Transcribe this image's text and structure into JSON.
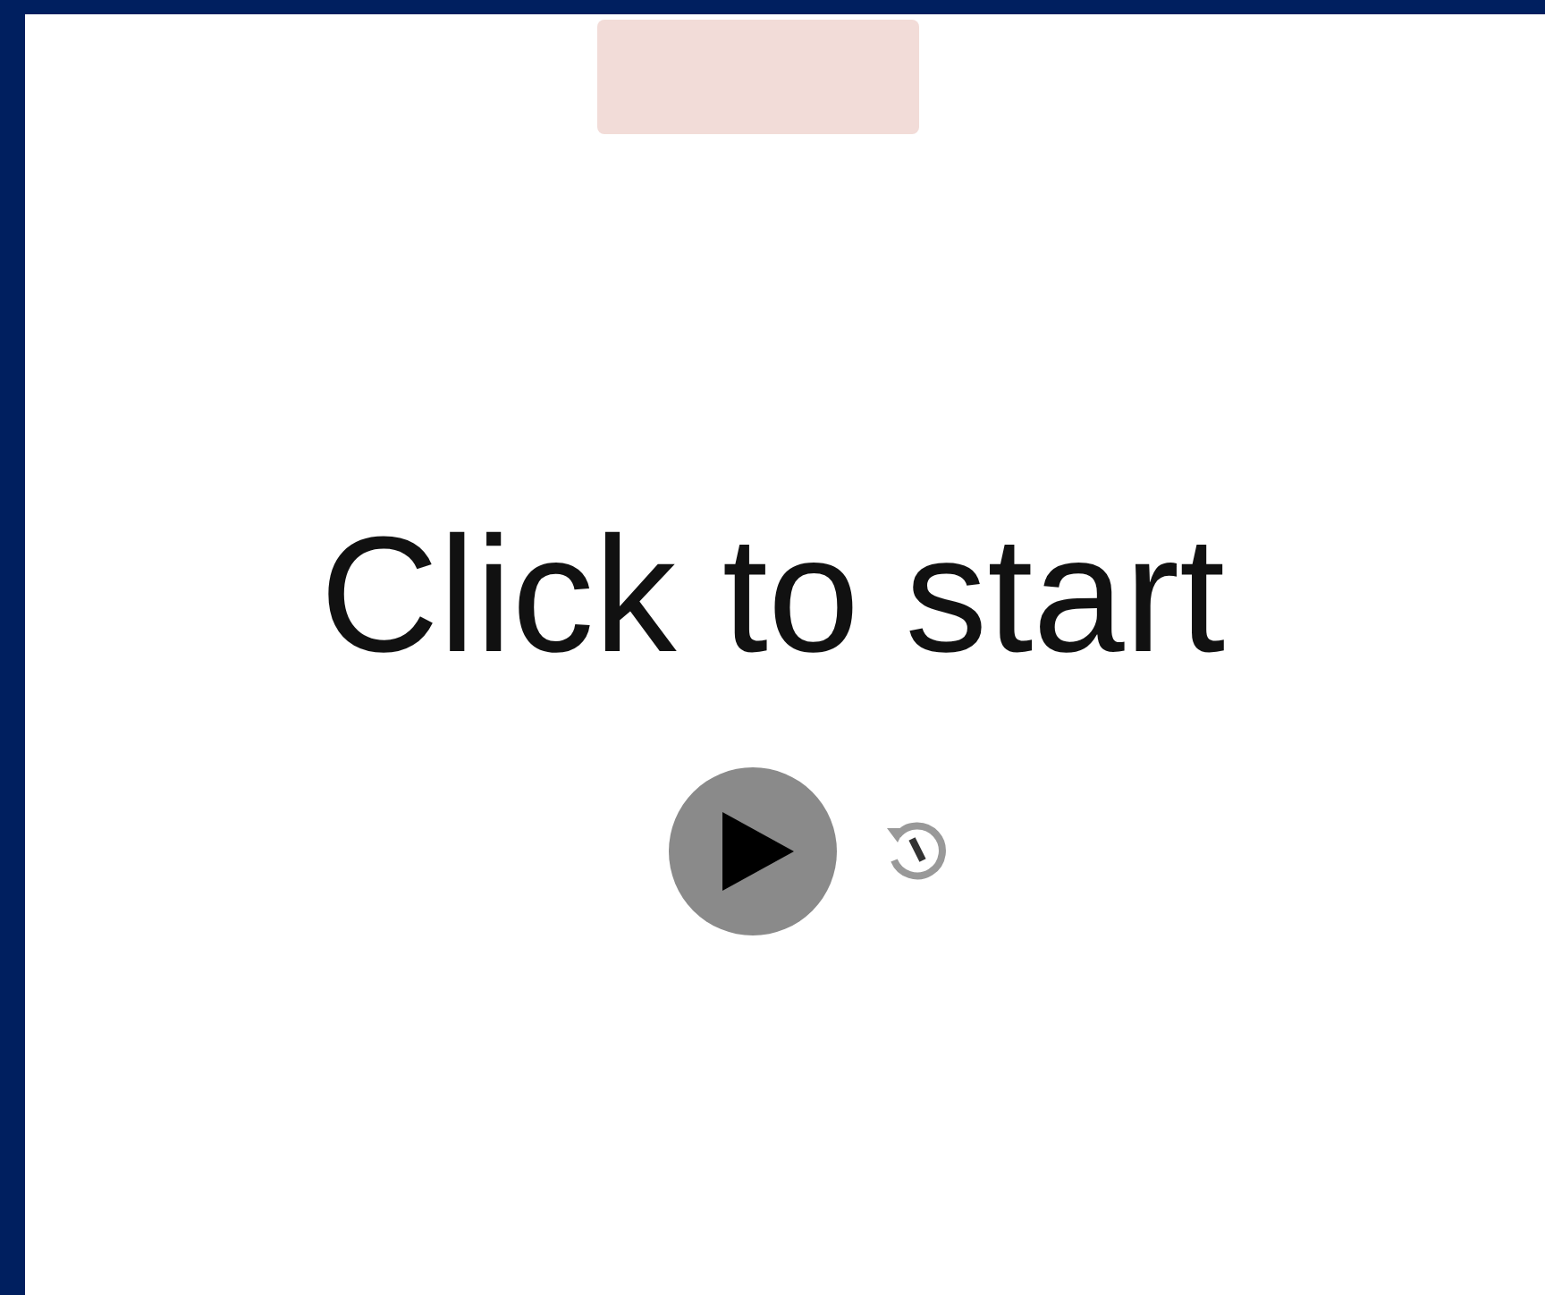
{
  "heading": "Click to start"
}
